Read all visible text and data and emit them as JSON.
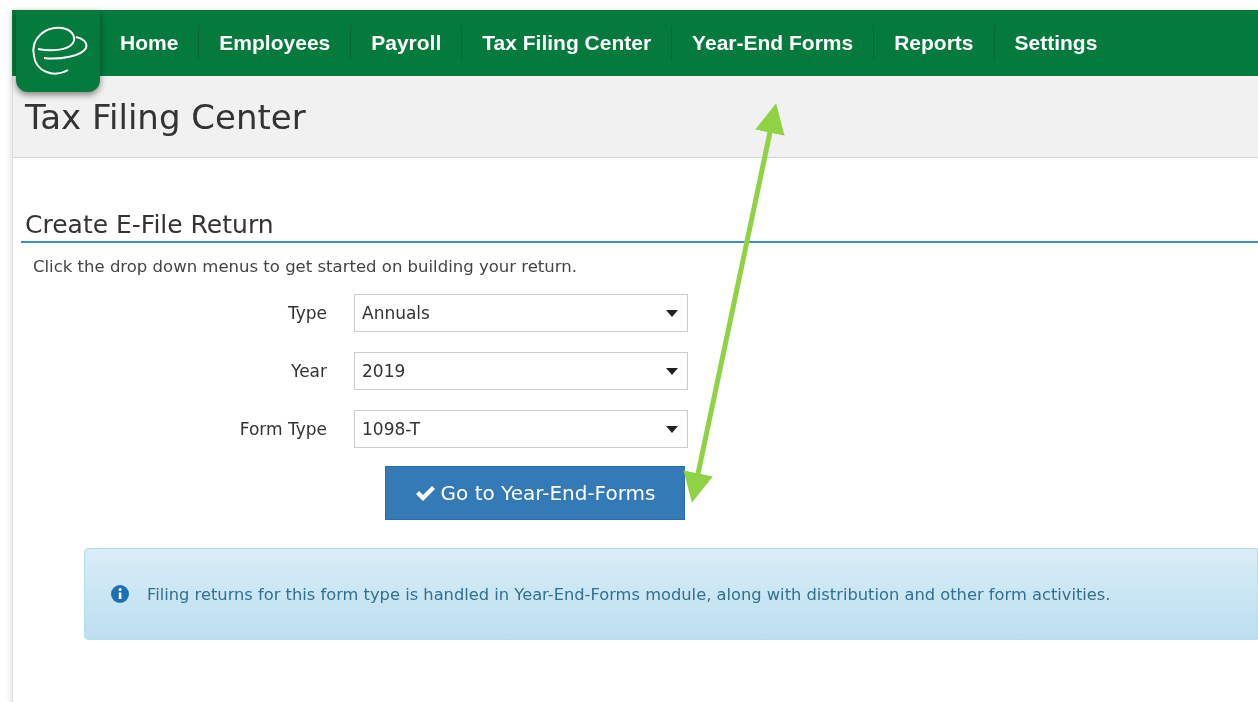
{
  "nav": {
    "items": [
      {
        "label": "Home"
      },
      {
        "label": "Employees"
      },
      {
        "label": "Payroll"
      },
      {
        "label": "Tax Filing Center"
      },
      {
        "label": "Year-End Forms"
      },
      {
        "label": "Reports"
      },
      {
        "label": "Settings"
      }
    ]
  },
  "page_title": "Tax Filing Center",
  "section": {
    "title": "Create E-File Return",
    "description": "Click the drop down menus to get started on building your return.",
    "fields": [
      {
        "label": "Type",
        "value": "Annuals"
      },
      {
        "label": "Year",
        "value": "2019"
      },
      {
        "label": "Form Type",
        "value": "1098-T"
      }
    ],
    "button": "Go to Year-End-Forms",
    "alert": "Filing returns for this form type is handled in Year-End-Forms module, along with distribution and other form activities."
  }
}
